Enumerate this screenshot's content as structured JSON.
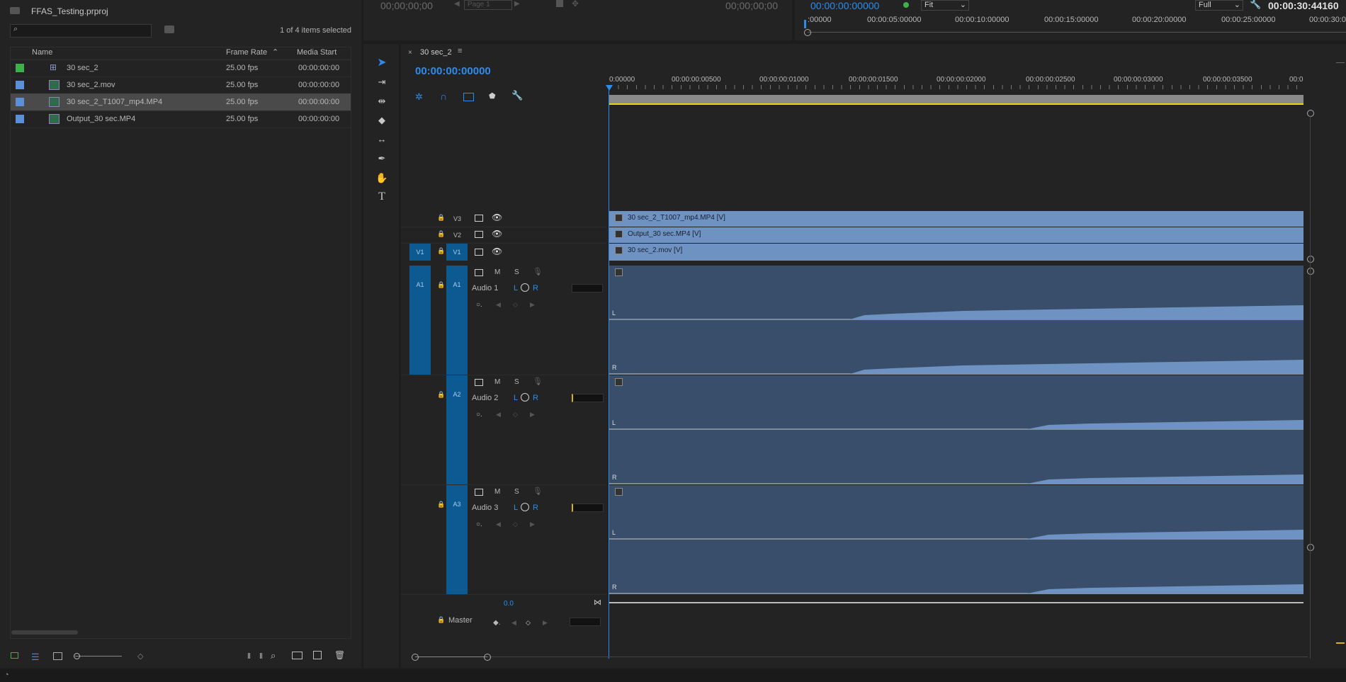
{
  "project": {
    "title": "FFAS_Testing.prproj",
    "search_placeholder": "",
    "selection_count": "1 of 4 items selected",
    "columns": [
      "Name",
      "Frame Rate",
      "Media Start"
    ],
    "items": [
      {
        "name": "30 sec_2",
        "frame_rate": "25.00 fps",
        "media_start": "00:00:00:00",
        "color": "#3eb04a",
        "icon": "sequence-icon"
      },
      {
        "name": "30 sec_2.mov",
        "frame_rate": "25.00 fps",
        "media_start": "00:00:00:00",
        "color": "#5b8fd6",
        "icon": "media-icon"
      },
      {
        "name": "30 sec_2_T1007_mp4.MP4",
        "frame_rate": "25.00 fps",
        "media_start": "00:00:00:00",
        "color": "#5b8fd6",
        "icon": "media-icon"
      },
      {
        "name": "Output_30 sec.MP4",
        "frame_rate": "25.00 fps",
        "media_start": "00:00:00:00",
        "color": "#5b8fd6",
        "icon": "media-icon"
      }
    ]
  },
  "program_monitor": {
    "timecode_left": "00;00;00;00",
    "page": "Page 1",
    "timecode_right": "00;00;00;00"
  },
  "source_monitor": {
    "timecode": "00:00:00:00000",
    "fit": "Fit",
    "quality": "Full",
    "duration": "00:00:30:44160",
    "ruler": [
      ":00000",
      "00:00:05:00000",
      "00:00:10:00000",
      "00:00:15:00000",
      "00:00:20:00000",
      "00:00:25:00000",
      "00:00:30:00"
    ]
  },
  "timeline": {
    "tab": "30 sec_2",
    "timecode": "00:00:00:00000",
    "ruler": [
      "0:00000",
      "00:00:00:00500",
      "00:00:00:01000",
      "00:00:00:01500",
      "00:00:00:02000",
      "00:00:00:02500",
      "00:00:00:03000",
      "00:00:00:03500",
      "00:0"
    ],
    "video_tracks": [
      {
        "id": "V3",
        "clip": "30 sec_2_T1007_mp4.MP4 [V]"
      },
      {
        "id": "V2",
        "clip": "Output_30 sec.MP4 [V]"
      },
      {
        "id": "V1",
        "clip": "30 sec_2.mov [V]"
      }
    ],
    "audio_tracks": [
      {
        "id": "A1",
        "name": "Audio 1"
      },
      {
        "id": "A2",
        "name": "Audio 2"
      },
      {
        "id": "A3",
        "name": "Audio 3"
      }
    ],
    "master_label": "Master",
    "master_value": "0.0",
    "source_v1": "V1",
    "source_a1": "A1",
    "M": "M",
    "S": "S",
    "L": "L",
    "R": "R"
  }
}
